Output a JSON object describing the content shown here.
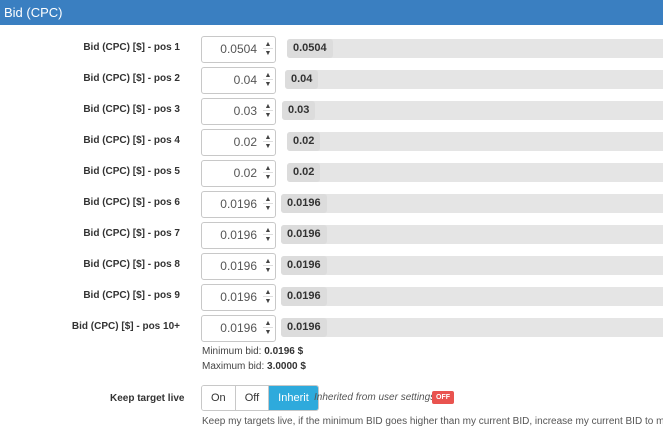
{
  "panel": {
    "title": "Bid (CPC)"
  },
  "rows": [
    {
      "label": "Bid (CPC) [$] - pos 1",
      "value": "0.0504",
      "result": "0.0504"
    },
    {
      "label": "Bid (CPC) [$] - pos 2",
      "value": "0.04",
      "result": "0.04"
    },
    {
      "label": "Bid (CPC) [$] - pos 3",
      "value": "0.03",
      "result": "0.03"
    },
    {
      "label": "Bid (CPC) [$] - pos 4",
      "value": "0.02",
      "result": "0.02"
    },
    {
      "label": "Bid (CPC) [$] - pos 5",
      "value": "0.02",
      "result": "0.02"
    },
    {
      "label": "Bid (CPC) [$] - pos 6",
      "value": "0.0196",
      "result": "0.0196"
    },
    {
      "label": "Bid (CPC) [$] - pos 7",
      "value": "0.0196",
      "result": "0.0196"
    },
    {
      "label": "Bid (CPC) [$] - pos 8",
      "value": "0.0196",
      "result": "0.0196"
    },
    {
      "label": "Bid (CPC) [$] - pos 9",
      "value": "0.0196",
      "result": "0.0196"
    },
    {
      "label": "Bid (CPC) [$] - pos 10+",
      "value": "0.0196",
      "result": "0.0196"
    }
  ],
  "bounds": {
    "min_label": "Minimum bid:",
    "min_value": "0.0196 $",
    "max_label": "Maximum bid:",
    "max_value": "3.0000 $"
  },
  "keep_target": {
    "label": "Keep target live",
    "options": [
      "On",
      "Off",
      "Inherit"
    ],
    "selected": "Inherit",
    "inherit_note": "Inherited from user settings",
    "inherit_status": "OFF",
    "help": "Keep my targets live, if the minimum BID goes higher than my current BID, increase my current BID to match"
  },
  "colors": {
    "header": "#3a7fc1",
    "active": "#2eaadc",
    "off_badge": "#e9534f"
  }
}
